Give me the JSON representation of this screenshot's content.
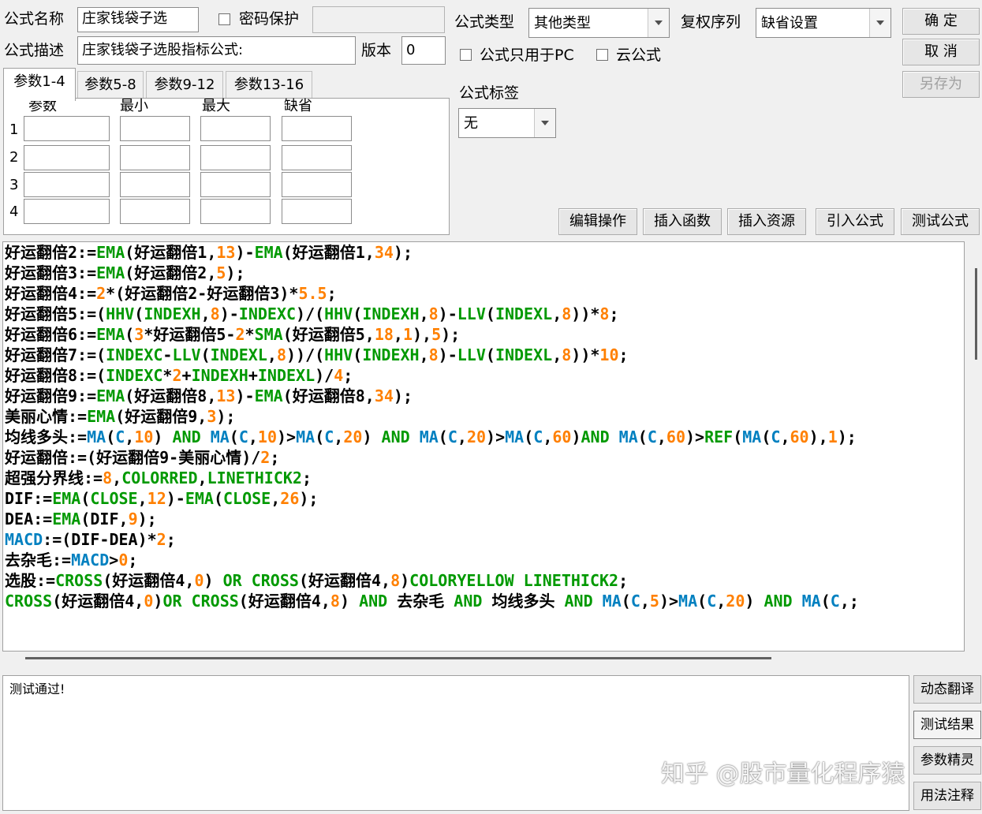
{
  "header": {
    "name_label": "公式名称",
    "name_value": "庄家钱袋子选",
    "password_label": "密码保护",
    "desc_label": "公式描述",
    "desc_value": "庄家钱袋子选股指标公式:",
    "version_label": "版本",
    "version_value": "0",
    "type_label": "公式类型",
    "type_value": "其他类型",
    "rights_label": "复权序列",
    "rights_value": "缺省设置",
    "pc_only_label": "公式只用于PC",
    "cloud_label": "云公式",
    "tag_label": "公式标签",
    "tag_value": "无"
  },
  "buttons": {
    "ok": "确 定",
    "cancel": "取 消",
    "save_as": "另存为",
    "edit_ops": "编辑操作",
    "insert_func": "插入函数",
    "insert_res": "插入资源",
    "import_formula": "引入公式",
    "test_formula": "测试公式"
  },
  "params": {
    "tabs": [
      "参数1-4",
      "参数5-8",
      "参数9-12",
      "参数13-16"
    ],
    "columns": [
      "参数",
      "最小",
      "最大",
      "缺省"
    ],
    "rows": [
      "1",
      "2",
      "3",
      "4"
    ]
  },
  "code_lines": [
    [
      [
        "k",
        "好运翻倍2:="
      ],
      [
        "g",
        "EMA"
      ],
      [
        "k",
        "(好运翻倍1,"
      ],
      [
        "o",
        "13"
      ],
      [
        "k",
        ")-"
      ],
      [
        "g",
        "EMA"
      ],
      [
        "k",
        "(好运翻倍1,"
      ],
      [
        "o",
        "34"
      ],
      [
        "k",
        ");"
      ]
    ],
    [
      [
        "k",
        "好运翻倍3:="
      ],
      [
        "g",
        "EMA"
      ],
      [
        "k",
        "(好运翻倍2,"
      ],
      [
        "o",
        "5"
      ],
      [
        "k",
        ");"
      ]
    ],
    [
      [
        "k",
        "好运翻倍4:="
      ],
      [
        "o",
        "2"
      ],
      [
        "k",
        "*(好运翻倍2-好运翻倍3)*"
      ],
      [
        "o",
        "5.5"
      ],
      [
        "k",
        ";"
      ]
    ],
    [
      [
        "k",
        "好运翻倍5:=("
      ],
      [
        "g",
        "HHV"
      ],
      [
        "k",
        "("
      ],
      [
        "g",
        "INDEXH"
      ],
      [
        "k",
        ","
      ],
      [
        "o",
        "8"
      ],
      [
        "k",
        ")-"
      ],
      [
        "g",
        "INDEXC"
      ],
      [
        "k",
        ")/("
      ],
      [
        "g",
        "HHV"
      ],
      [
        "k",
        "("
      ],
      [
        "g",
        "INDEXH"
      ],
      [
        "k",
        ","
      ],
      [
        "o",
        "8"
      ],
      [
        "k",
        ")-"
      ],
      [
        "g",
        "LLV"
      ],
      [
        "k",
        "("
      ],
      [
        "g",
        "INDEXL"
      ],
      [
        "k",
        ","
      ],
      [
        "o",
        "8"
      ],
      [
        "k",
        "))*"
      ],
      [
        "o",
        "8"
      ],
      [
        "k",
        ";"
      ]
    ],
    [
      [
        "k",
        "好运翻倍6:="
      ],
      [
        "g",
        "EMA"
      ],
      [
        "k",
        "("
      ],
      [
        "o",
        "3"
      ],
      [
        "k",
        "*好运翻倍5-"
      ],
      [
        "o",
        "2"
      ],
      [
        "k",
        "*"
      ],
      [
        "g",
        "SMA"
      ],
      [
        "k",
        "(好运翻倍5,"
      ],
      [
        "o",
        "18"
      ],
      [
        "k",
        ","
      ],
      [
        "o",
        "1"
      ],
      [
        "k",
        "),"
      ],
      [
        "o",
        "5"
      ],
      [
        "k",
        ");"
      ]
    ],
    [
      [
        "k",
        "好运翻倍7:=("
      ],
      [
        "g",
        "INDEXC"
      ],
      [
        "k",
        "-"
      ],
      [
        "g",
        "LLV"
      ],
      [
        "k",
        "("
      ],
      [
        "g",
        "INDEXL"
      ],
      [
        "k",
        ","
      ],
      [
        "o",
        "8"
      ],
      [
        "k",
        "))/("
      ],
      [
        "g",
        "HHV"
      ],
      [
        "k",
        "("
      ],
      [
        "g",
        "INDEXH"
      ],
      [
        "k",
        ","
      ],
      [
        "o",
        "8"
      ],
      [
        "k",
        ")-"
      ],
      [
        "g",
        "LLV"
      ],
      [
        "k",
        "("
      ],
      [
        "g",
        "INDEXL"
      ],
      [
        "k",
        ","
      ],
      [
        "o",
        "8"
      ],
      [
        "k",
        "))*"
      ],
      [
        "o",
        "10"
      ],
      [
        "k",
        ";"
      ]
    ],
    [
      [
        "k",
        "好运翻倍8:=("
      ],
      [
        "g",
        "INDEXC"
      ],
      [
        "k",
        "*"
      ],
      [
        "o",
        "2"
      ],
      [
        "k",
        "+"
      ],
      [
        "g",
        "INDEXH"
      ],
      [
        "k",
        "+"
      ],
      [
        "g",
        "INDEXL"
      ],
      [
        "k",
        ")/"
      ],
      [
        "o",
        "4"
      ],
      [
        "k",
        ";"
      ]
    ],
    [
      [
        "k",
        "好运翻倍9:="
      ],
      [
        "g",
        "EMA"
      ],
      [
        "k",
        "(好运翻倍8,"
      ],
      [
        "o",
        "13"
      ],
      [
        "k",
        ")-"
      ],
      [
        "g",
        "EMA"
      ],
      [
        "k",
        "(好运翻倍8,"
      ],
      [
        "o",
        "34"
      ],
      [
        "k",
        ");"
      ]
    ],
    [
      [
        "k",
        "美丽心情:="
      ],
      [
        "g",
        "EMA"
      ],
      [
        "k",
        "(好运翻倍9,"
      ],
      [
        "o",
        "3"
      ],
      [
        "k",
        ");"
      ]
    ],
    [
      [
        "k",
        "均线多头:="
      ],
      [
        "b",
        "MA"
      ],
      [
        "k",
        "("
      ],
      [
        "b",
        "C"
      ],
      [
        "k",
        ","
      ],
      [
        "o",
        "10"
      ],
      [
        "k",
        ") "
      ],
      [
        "g",
        "AND"
      ],
      [
        "k",
        " "
      ],
      [
        "b",
        "MA"
      ],
      [
        "k",
        "("
      ],
      [
        "b",
        "C"
      ],
      [
        "k",
        ","
      ],
      [
        "o",
        "10"
      ],
      [
        "k",
        ")>"
      ],
      [
        "b",
        "MA"
      ],
      [
        "k",
        "("
      ],
      [
        "b",
        "C"
      ],
      [
        "k",
        ","
      ],
      [
        "o",
        "20"
      ],
      [
        "k",
        ") "
      ],
      [
        "g",
        "AND"
      ],
      [
        "k",
        " "
      ],
      [
        "b",
        "MA"
      ],
      [
        "k",
        "("
      ],
      [
        "b",
        "C"
      ],
      [
        "k",
        ","
      ],
      [
        "o",
        "20"
      ],
      [
        "k",
        ")>"
      ],
      [
        "b",
        "MA"
      ],
      [
        "k",
        "("
      ],
      [
        "b",
        "C"
      ],
      [
        "k",
        ","
      ],
      [
        "o",
        "60"
      ],
      [
        "k",
        ")"
      ],
      [
        "g",
        "AND"
      ],
      [
        "k",
        " "
      ],
      [
        "b",
        "MA"
      ],
      [
        "k",
        "("
      ],
      [
        "b",
        "C"
      ],
      [
        "k",
        ","
      ],
      [
        "o",
        "60"
      ],
      [
        "k",
        ")>"
      ],
      [
        "g",
        "REF"
      ],
      [
        "k",
        "("
      ],
      [
        "b",
        "MA"
      ],
      [
        "k",
        "("
      ],
      [
        "b",
        "C"
      ],
      [
        "k",
        ","
      ],
      [
        "o",
        "60"
      ],
      [
        "k",
        "),"
      ],
      [
        "o",
        "1"
      ],
      [
        "k",
        ");"
      ]
    ],
    [
      [
        "k",
        "好运翻倍:=(好运翻倍9-美丽心情)/"
      ],
      [
        "o",
        "2"
      ],
      [
        "k",
        ";"
      ]
    ],
    [
      [
        "k",
        "超强分界线:="
      ],
      [
        "o",
        "8"
      ],
      [
        "k",
        ","
      ],
      [
        "g",
        "COLORRED"
      ],
      [
        "k",
        ","
      ],
      [
        "g",
        "LINETHICK2"
      ],
      [
        "k",
        ";"
      ]
    ],
    [
      [
        "k",
        "DIF:="
      ],
      [
        "g",
        "EMA"
      ],
      [
        "k",
        "("
      ],
      [
        "g",
        "CLOSE"
      ],
      [
        "k",
        ","
      ],
      [
        "o",
        "12"
      ],
      [
        "k",
        ")-"
      ],
      [
        "g",
        "EMA"
      ],
      [
        "k",
        "("
      ],
      [
        "g",
        "CLOSE"
      ],
      [
        "k",
        ","
      ],
      [
        "o",
        "26"
      ],
      [
        "k",
        ");"
      ]
    ],
    [
      [
        "k",
        "DEA:="
      ],
      [
        "g",
        "EMA"
      ],
      [
        "k",
        "(DIF,"
      ],
      [
        "o",
        "9"
      ],
      [
        "k",
        ");"
      ]
    ],
    [
      [
        "b",
        "MACD"
      ],
      [
        "k",
        ":=(DIF-DEA)*"
      ],
      [
        "o",
        "2"
      ],
      [
        "k",
        ";"
      ]
    ],
    [
      [
        "k",
        "去杂毛:="
      ],
      [
        "b",
        "MACD"
      ],
      [
        "k",
        ">"
      ],
      [
        "o",
        "0"
      ],
      [
        "k",
        ";"
      ]
    ],
    [
      [
        "k",
        "选股:="
      ],
      [
        "g",
        "CROSS"
      ],
      [
        "k",
        "(好运翻倍4,"
      ],
      [
        "o",
        "0"
      ],
      [
        "k",
        ") "
      ],
      [
        "g",
        "OR"
      ],
      [
        "k",
        " "
      ],
      [
        "g",
        "CROSS"
      ],
      [
        "k",
        "(好运翻倍4,"
      ],
      [
        "o",
        "8"
      ],
      [
        "k",
        ")"
      ],
      [
        "g",
        "COLORYELLOW"
      ],
      [
        "k",
        " "
      ],
      [
        "g",
        "LINETHICK2"
      ],
      [
        "k",
        ";"
      ]
    ],
    [
      [
        "g",
        "CROSS"
      ],
      [
        "k",
        "(好运翻倍4,"
      ],
      [
        "o",
        "0"
      ],
      [
        "k",
        ")"
      ],
      [
        "g",
        "OR"
      ],
      [
        "k",
        " "
      ],
      [
        "g",
        "CROSS"
      ],
      [
        "k",
        "(好运翻倍4,"
      ],
      [
        "o",
        "8"
      ],
      [
        "k",
        ") "
      ],
      [
        "g",
        "AND"
      ],
      [
        "k",
        " 去杂毛 "
      ],
      [
        "g",
        "AND"
      ],
      [
        "k",
        " 均线多头 "
      ],
      [
        "g",
        "AND"
      ],
      [
        "k",
        " "
      ],
      [
        "b",
        "MA"
      ],
      [
        "k",
        "("
      ],
      [
        "b",
        "C"
      ],
      [
        "k",
        ","
      ],
      [
        "o",
        "5"
      ],
      [
        "k",
        ")>"
      ],
      [
        "b",
        "MA"
      ],
      [
        "k",
        "("
      ],
      [
        "b",
        "C"
      ],
      [
        "k",
        ","
      ],
      [
        "o",
        "20"
      ],
      [
        "k",
        ") "
      ],
      [
        "g",
        "AND"
      ],
      [
        "k",
        " "
      ],
      [
        "b",
        "MA"
      ],
      [
        "k",
        "("
      ],
      [
        "b",
        "C"
      ],
      [
        "k",
        ",;"
      ]
    ]
  ],
  "output": {
    "text": "测试通过!"
  },
  "side_buttons": [
    "动态翻译",
    "测试结果",
    "参数精灵",
    "用法注释"
  ],
  "watermark": "知乎 @股市量化程序猿",
  "colors": {
    "function": "#009900",
    "variable_blue": "#0080c0",
    "number": "#ff8000"
  }
}
